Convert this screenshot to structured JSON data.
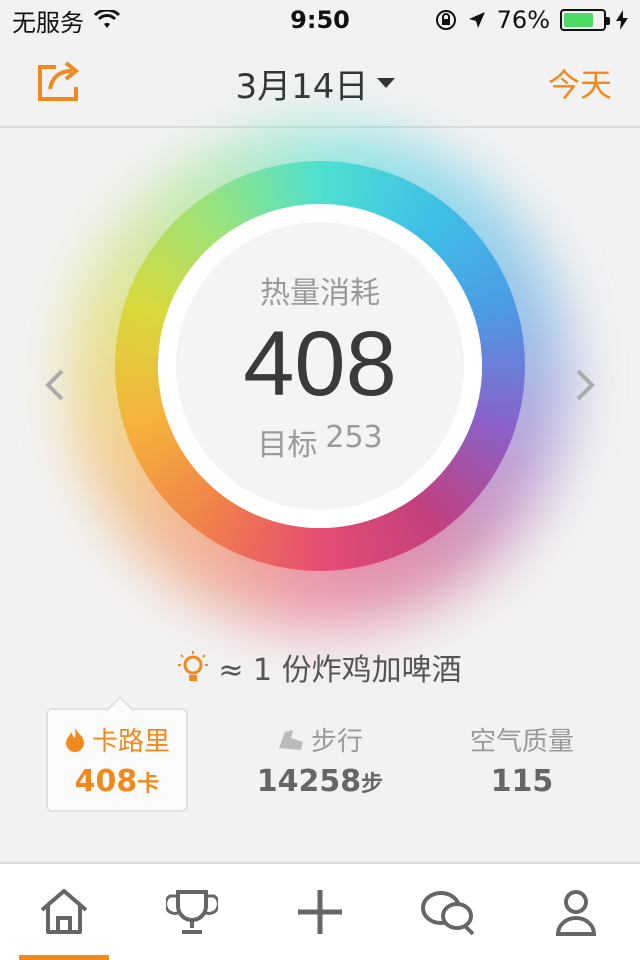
{
  "status_bar": {
    "carrier": "无服务",
    "time": "9:50",
    "battery_percent": "76%",
    "battery_level": 0.76,
    "battery_color": "#4cd964"
  },
  "nav": {
    "share_icon": "share-icon",
    "date": "3月14日",
    "today": "今天",
    "accent": "#f08a1c"
  },
  "ring": {
    "title": "热量消耗",
    "value": "408",
    "goal_label": "目标",
    "goal_value": "253"
  },
  "equivalent": {
    "text": "≈ 1 份炸鸡加啤酒",
    "icon": "lightbulb-icon"
  },
  "stats": [
    {
      "label": "卡路里",
      "value": "408",
      "unit": "卡",
      "icon": "flame-icon"
    },
    {
      "label": "步行",
      "value": "14258",
      "unit": "步",
      "icon": "shoe-icon"
    },
    {
      "label": "空气质量",
      "value": "115",
      "unit": ""
    }
  ],
  "tabs": [
    {
      "icon": "home-icon"
    },
    {
      "icon": "trophy-icon"
    },
    {
      "icon": "add-icon"
    },
    {
      "icon": "chat-icon"
    },
    {
      "icon": "profile-icon"
    }
  ]
}
